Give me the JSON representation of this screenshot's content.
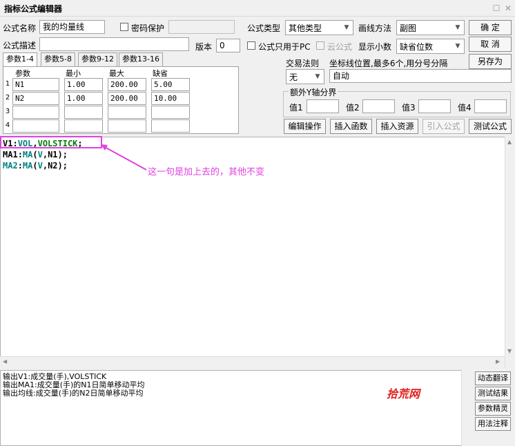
{
  "window": {
    "title": "指标公式编辑器"
  },
  "fields": {
    "name_label": "公式名称",
    "name_value": "我的均量线",
    "password_label": "密码保护",
    "type_label": "公式类型",
    "type_value": "其他类型",
    "draw_label": "画线方法",
    "draw_value": "副图",
    "desc_label": "公式描述",
    "desc_value": "",
    "version_label": "版本",
    "version_value": "0",
    "pc_only_label": "公式只用于PC",
    "cloud_label": "云公式",
    "decimals_label": "显示小数",
    "decimals_value": "缺省位数",
    "trade_rule_label": "交易法则",
    "trade_rule_value": "无",
    "coord_label": "坐标线位置,最多6个,用分号分隔",
    "coord_value": "自动",
    "yaxis_group_label": "额外Y轴分界",
    "y1_label": "值1",
    "y2_label": "值2",
    "y3_label": "值3",
    "y4_label": "值4"
  },
  "buttons": {
    "ok": "确  定",
    "cancel": "取  消",
    "save_as": "另存为",
    "edit_ops": "编辑操作",
    "insert_func": "插入函数",
    "insert_resource": "插入资源",
    "import_formula": "引入公式",
    "test_formula": "测试公式",
    "dynamic_translate": "动态翻译",
    "test_result": "测试结果",
    "param_wizard": "参数精灵",
    "usage_notes": "用法注释"
  },
  "tabs": [
    "参数1-4",
    "参数5-8",
    "参数9-12",
    "参数13-16"
  ],
  "params": {
    "headers": [
      "参数",
      "最小",
      "最大",
      "缺省"
    ],
    "rows": [
      {
        "num": "1",
        "name": "N1",
        "min": "1.00",
        "max": "200.00",
        "def": "5.00"
      },
      {
        "num": "2",
        "name": "N2",
        "min": "1.00",
        "max": "200.00",
        "def": "10.00"
      },
      {
        "num": "3",
        "name": "",
        "min": "",
        "max": "",
        "def": ""
      },
      {
        "num": "4",
        "name": "",
        "min": "",
        "max": "",
        "def": ""
      }
    ]
  },
  "code": {
    "line1": {
      "name": "V1",
      "sep": ":",
      "arg1": "VOL",
      "comma": ",",
      "arg2": "VOLSTICK",
      "end": ";"
    },
    "line2": {
      "name": "MA1",
      "sep": ":",
      "func": "MA",
      "open": "(",
      "arg1": "V",
      "rest": ",N1);"
    },
    "line3": {
      "name": "MA2",
      "sep": ":",
      "func": "MA",
      "open": "(",
      "arg1": "V",
      "rest": ",N2);"
    }
  },
  "annotation": "这一句是加上去的，其他不变",
  "output": [
    "输出V1:成交量(手),VOLSTICK",
    "输出MA1:成交量(手)的N1日简单移动平均",
    "输出均线:成交量(手)的N2日简单移动平均"
  ],
  "watermark": "拾荒网",
  "colors": {
    "annotation": "#e040e0",
    "watermark": "#e02020"
  }
}
